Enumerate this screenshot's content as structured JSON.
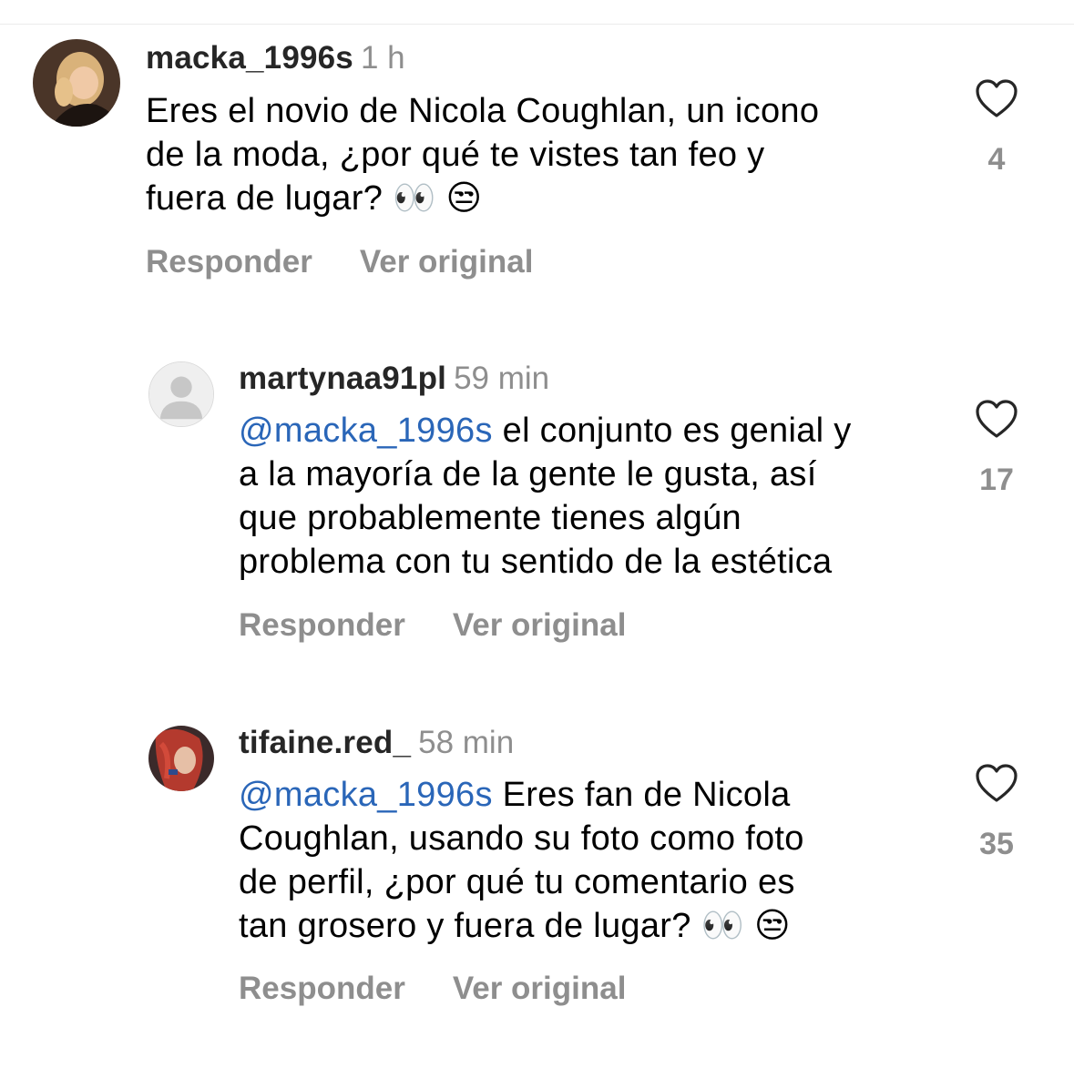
{
  "comments": [
    {
      "username": "macka_1996s",
      "time": "1 h",
      "lines": [
        "Eres el novio de Nicola Coughlan, un icono",
        "de la moda, ¿por qué te vistes tan feo y",
        "fuera de lugar? 👀 😒"
      ],
      "actions": {
        "reply": "Responder",
        "original": "Ver original"
      },
      "likes": "4",
      "avatar": "profile-photo"
    },
    {
      "username": "martynaa91pl",
      "time": "59 min",
      "mention": "@macka_1996s",
      "lines": [
        " el conjunto es genial y",
        "a la mayoría de la gente le gusta, así",
        "que probablemente tienes algún",
        "problema con tu sentido de la estética"
      ],
      "actions": {
        "reply": "Responder",
        "original": "Ver original"
      },
      "likes": "17",
      "avatar": "default-avatar"
    },
    {
      "username": "tifaine.red_",
      "time": "58 min",
      "mention": "@macka_1996s",
      "lines": [
        " Eres fan de Nicola",
        "Coughlan, usando su foto como foto",
        "de perfil, ¿por qué tu comentario es",
        "tan grosero y fuera de lugar? 👀 😒"
      ],
      "actions": {
        "reply": "Responder",
        "original": "Ver original"
      },
      "likes": "35",
      "avatar": "profile-photo"
    }
  ],
  "icons": {
    "like": "heart-outline-icon"
  },
  "colors": {
    "mention": "#2a66b8",
    "secondary": "#8e8e8e",
    "username": "#262626"
  }
}
